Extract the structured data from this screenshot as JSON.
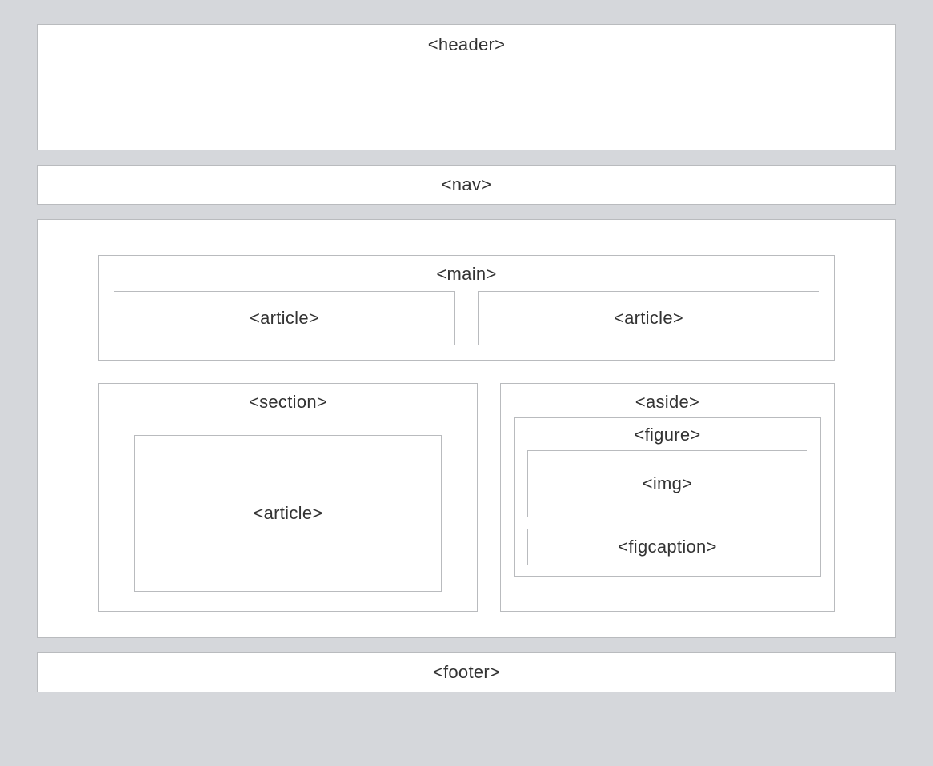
{
  "header": {
    "label": "<header>"
  },
  "nav": {
    "label": "<nav>"
  },
  "main": {
    "label": "<main>",
    "articles": [
      {
        "label": "<article>"
      },
      {
        "label": "<article>"
      }
    ]
  },
  "section": {
    "label": "<section>",
    "article": {
      "label": "<article>"
    }
  },
  "aside": {
    "label": "<aside>",
    "figure": {
      "label": "<figure>",
      "img": {
        "label": "<img>"
      },
      "figcaption": {
        "label": "<figcaption>"
      }
    }
  },
  "footer": {
    "label": "<footer>"
  }
}
